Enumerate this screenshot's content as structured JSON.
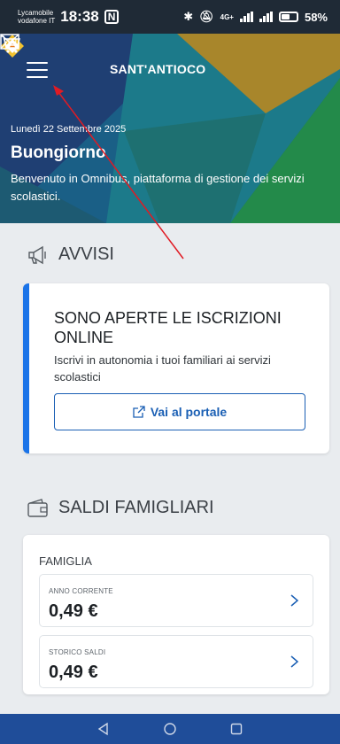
{
  "status": {
    "carrier_top": "Lycamobile",
    "carrier_bottom": "vodafone IT",
    "time": "18:38",
    "nfc": "N",
    "network": "4G+",
    "battery": "58%",
    "battery_level": 0.58
  },
  "header": {
    "city": "SANT'ANTIOCO",
    "date": "Lunedì 22 Settembre 2025",
    "greeting": "Buongiorno",
    "welcome": "Benvenuto in Omnibus, piattaforma di gestione dei servizi scolastici."
  },
  "avvisi": {
    "title": "AVVISI",
    "notice_title": "SONO APERTE LE ISCRIZIONI ONLINE",
    "notice_text": "Iscrivi in autonomia i tuoi familiari ai servizi scolastici",
    "button_label": "Vai al portale"
  },
  "saldi": {
    "title": "SALDI FAMIGLIARI",
    "family_label": "FAMIGLIA",
    "items": [
      {
        "label": "ANNO CORRENTE",
        "value": "0,49 €"
      },
      {
        "label": "STORICO SALDI",
        "value": "0,49 €"
      }
    ]
  },
  "colors": {
    "accent": "#1a73e8",
    "nav": "#1f4d99",
    "annotation": "#e01b24"
  },
  "icons": [
    "menu-icon",
    "logo-icon",
    "mail-icon",
    "cart-icon",
    "megaphone-icon",
    "wallet-icon",
    "external-link-icon",
    "chevron-right-icon",
    "back-icon",
    "home-icon",
    "recents-icon"
  ]
}
